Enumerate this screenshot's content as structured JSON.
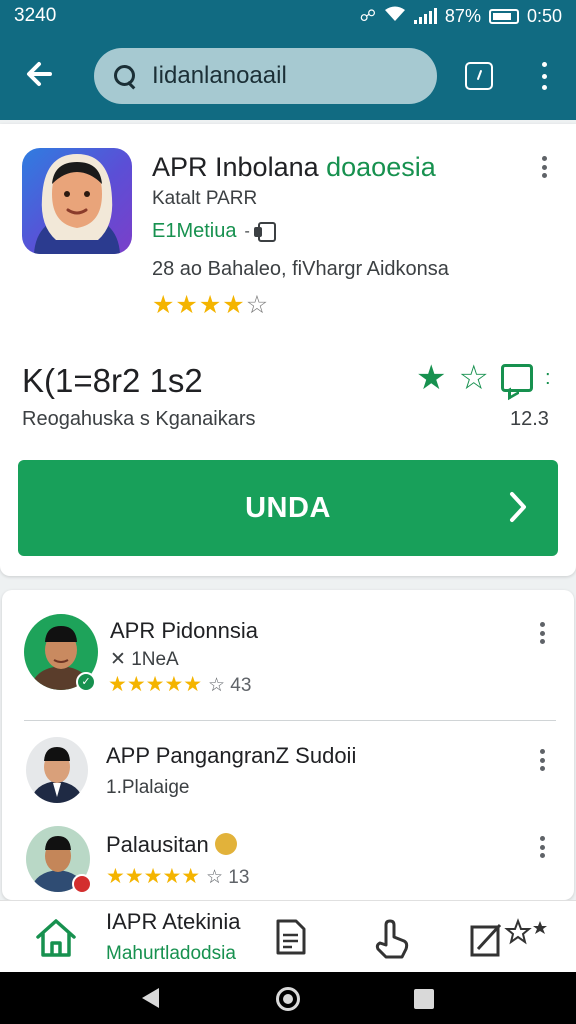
{
  "status_bar": {
    "time": "3240",
    "battery": "87%",
    "clock": "0:50"
  },
  "app_bar": {
    "search_value": "Iidanlanoaail",
    "search_placeholder": "Iidanlanoaail",
    "action_icon": "tablet-icon",
    "overflow_icon": "more-vert-icon"
  },
  "app_detail": {
    "title_main": "APR Inbolana ",
    "title_accent": "doaoesia",
    "developer": "Katalt PARR",
    "category": "E1Metiua",
    "category_chevron": "-",
    "meta_line": "28  ao Bahaleo, fiVhargr Aidkonsa",
    "rating_stars": 4,
    "stat_value": "K(1=8r2 1s2",
    "stat_subtitle": "Reogahuska s  Kganaikars",
    "stat_count": "12.3",
    "install_label": "UNDA",
    "accent_color": "#17914f",
    "button_color": "#18a05a"
  },
  "similar_apps": [
    {
      "title": "APR Pidonnsia",
      "subtitle": "✕ 1NeA",
      "stars": 5,
      "rating_text": "☆ 43"
    },
    {
      "title": "APP PangangranZ Sudoii",
      "subtitle": "1.Plalaige"
    },
    {
      "title": "Palausitan",
      "stars": 5,
      "rating_text": "☆ 13"
    }
  ],
  "bottom_nav": {
    "title": "IAPR Atekinia",
    "subtitle": "Mahurtladodsia",
    "icons": [
      "home-icon",
      "document-icon",
      "tap-icon",
      "edit-icon"
    ]
  }
}
